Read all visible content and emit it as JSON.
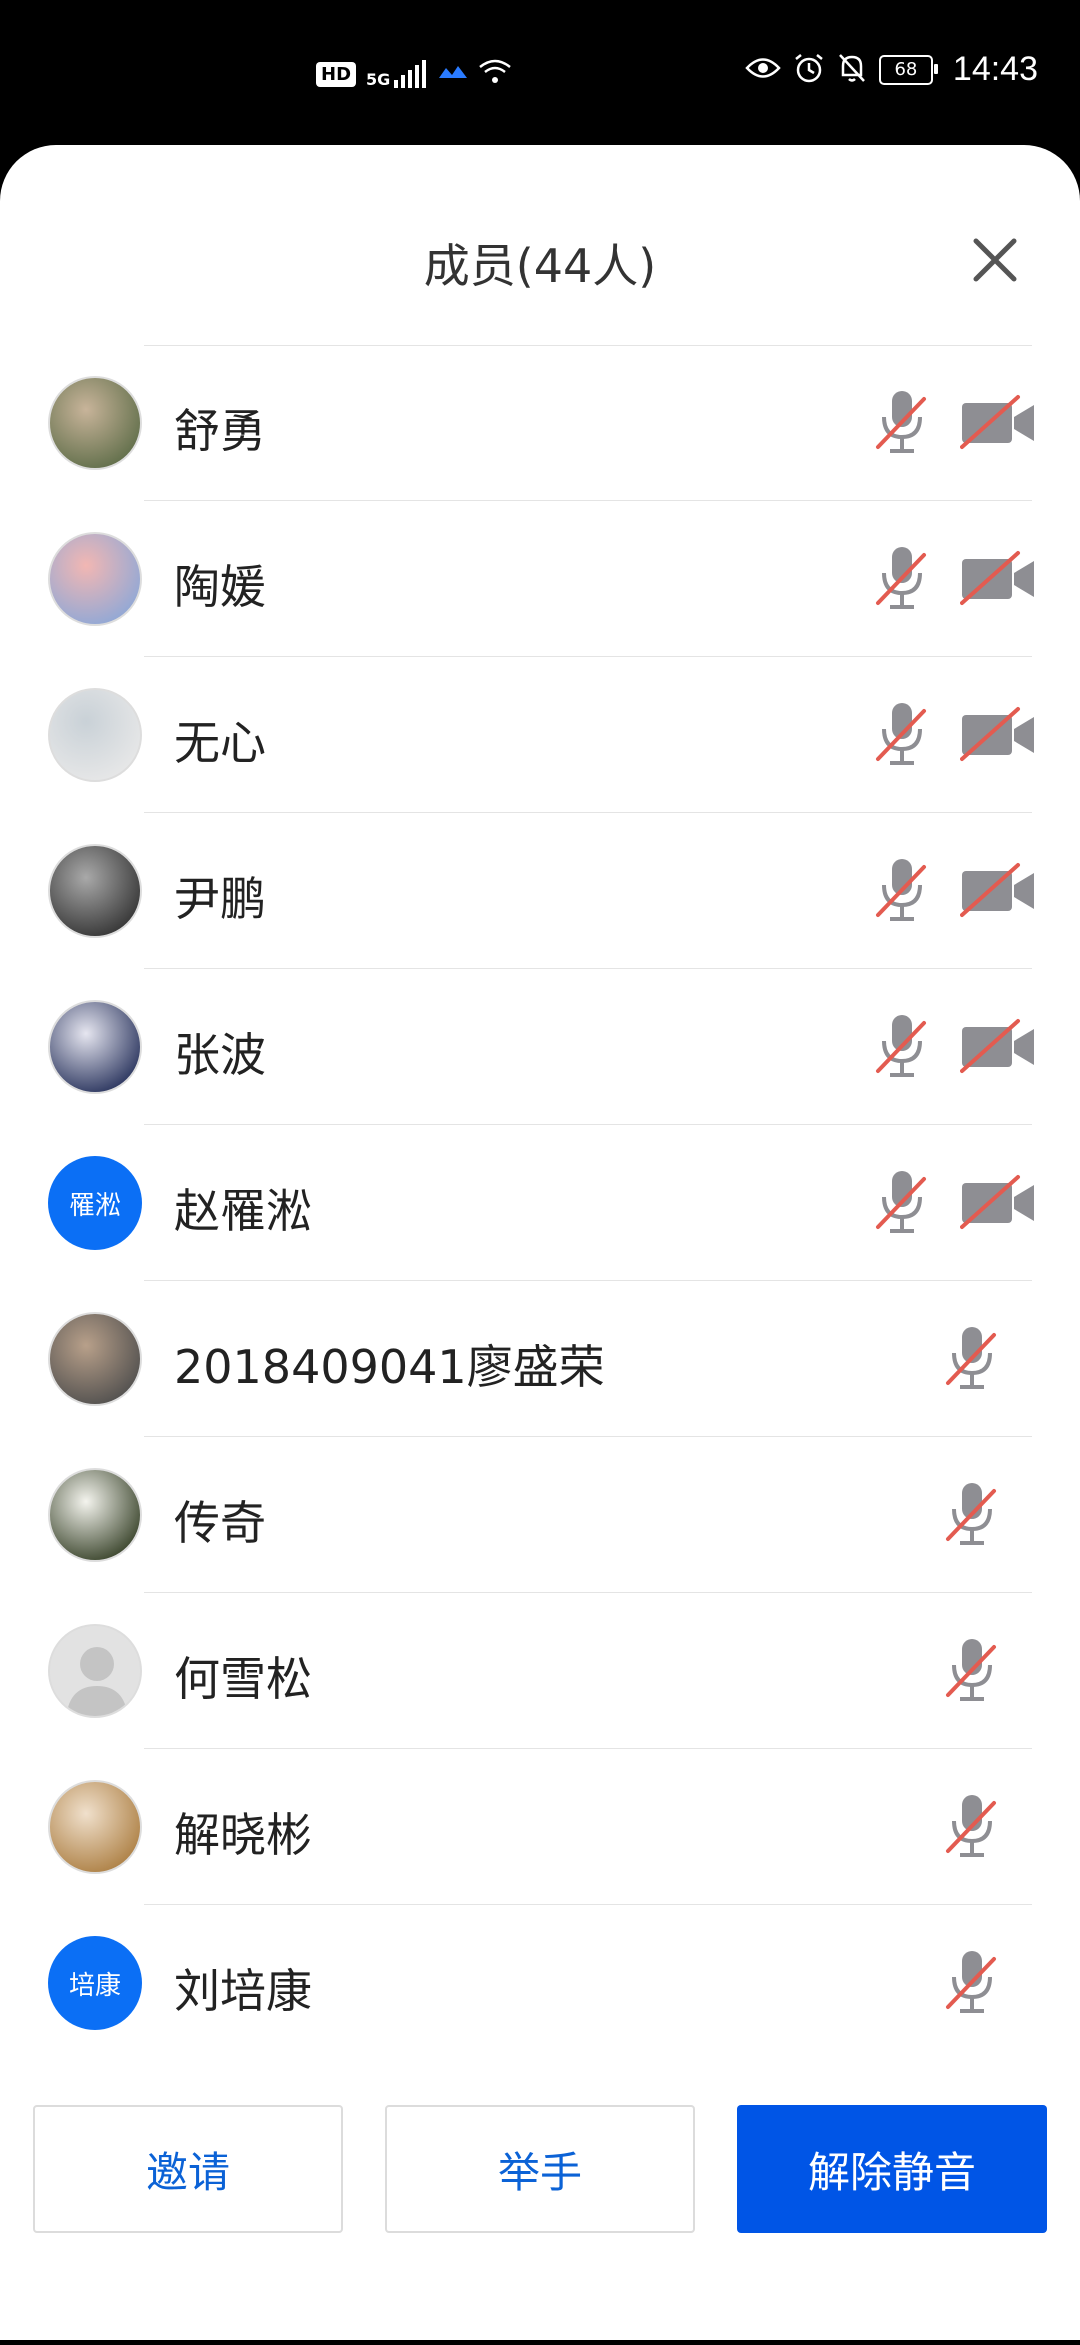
{
  "status_bar": {
    "hd": "HD",
    "network": "5G",
    "battery": "68",
    "time": "14:43"
  },
  "panel": {
    "title": "成员(44人)"
  },
  "members": [
    {
      "name": "舒勇",
      "avatar_type": "photo",
      "avatar_colors": [
        "#5a6a45",
        "#c8b49a"
      ],
      "mic_muted": true,
      "camera_off": true
    },
    {
      "name": "陶媛",
      "avatar_type": "photo",
      "avatar_colors": [
        "#8aa7d8",
        "#f2b7b3"
      ],
      "mic_muted": true,
      "camera_off": true
    },
    {
      "name": "无心",
      "avatar_type": "photo",
      "avatar_colors": [
        "#e9e9e9",
        "#c9d1d7"
      ],
      "mic_muted": true,
      "camera_off": true
    },
    {
      "name": "尹鹏",
      "avatar_type": "photo",
      "avatar_colors": [
        "#2e2e2e",
        "#a9a9a9"
      ],
      "mic_muted": true,
      "camera_off": true
    },
    {
      "name": "张波",
      "avatar_type": "photo",
      "avatar_colors": [
        "#1f2a55",
        "#e6e6f0"
      ],
      "mic_muted": true,
      "camera_off": true
    },
    {
      "name": "赵罹淞",
      "avatar_type": "text",
      "avatar_text": "罹淞",
      "mic_muted": true,
      "camera_off": true
    },
    {
      "name": "2018409041廖盛荣",
      "avatar_type": "photo",
      "avatar_colors": [
        "#4b4b4b",
        "#b8a08a"
      ],
      "mic_muted": true,
      "camera_off": false
    },
    {
      "name": "传奇",
      "avatar_type": "photo",
      "avatar_colors": [
        "#2f3a20",
        "#f4f4ee"
      ],
      "mic_muted": true,
      "camera_off": false
    },
    {
      "name": "何雪松",
      "avatar_type": "default",
      "avatar_colors": [
        "#e2e2e2",
        "#c4c4c4"
      ],
      "mic_muted": true,
      "camera_off": false
    },
    {
      "name": "解晓彬",
      "avatar_type": "photo",
      "avatar_colors": [
        "#a97a3c",
        "#f0e0cc"
      ],
      "mic_muted": true,
      "camera_off": false
    },
    {
      "name": "刘培康",
      "avatar_type": "text",
      "avatar_text": "培康",
      "mic_muted": true,
      "camera_off": false
    }
  ],
  "footer": {
    "invite_label": "邀请",
    "raise_hand_label": "举手",
    "unmute_label": "解除静音"
  },
  "colors": {
    "accent": "#0055e6",
    "muted_strike": "#e35b50",
    "icon_gray": "#8e8e93"
  }
}
